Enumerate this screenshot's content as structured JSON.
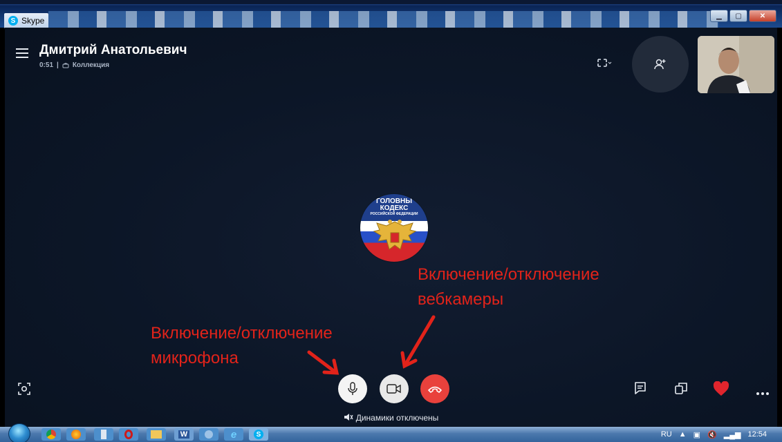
{
  "window": {
    "title": "Skype"
  },
  "call": {
    "contact_name": "Дмитрий Анатольевич",
    "duration": "0:51",
    "separator": "|",
    "collection_label": "Коллекция",
    "avatar_text_line1": "ГОЛОВНЫ",
    "avatar_text_line2": "КОДЕКС",
    "avatar_text_line3": "РОССИЙСКОЙ ФЕДЕРАЦИИ",
    "speakers_status": "Динамики отключены"
  },
  "annotations": {
    "webcam_line1": "Включение/отключение",
    "webcam_line2": "вебкамеры",
    "mic_line1": "Включение/отключение",
    "mic_line2": "микрофона",
    "color": "#e2231a"
  },
  "controls": {
    "end_call_color": "#e9413c",
    "heart_color": "#e0252d"
  },
  "taskbar": {
    "language": "RU",
    "clock": "12:54",
    "word_label": "W"
  }
}
